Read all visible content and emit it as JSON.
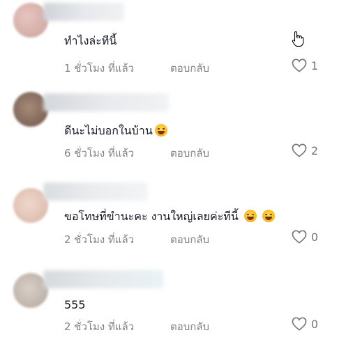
{
  "comments": [
    {
      "text": "ทำไงล่ะทีนี้",
      "time": "1 ชั่วโมง ที่แล้ว",
      "reply": "ตอบกลับ",
      "likes": "1",
      "emojis": 0
    },
    {
      "text": "ดีนะไม่บอกในบ้าน",
      "time": "6 ชั่วโมง ที่แล้ว",
      "reply": "ตอบกลับ",
      "likes": "2",
      "emojis": 1
    },
    {
      "text": "ขอโทษที่ขำนะคะ งานใหญ่เลยค่ะทีนี้",
      "time": "2 ชั่วโมง ที่แล้ว",
      "reply": "ตอบกลับ",
      "likes": "0",
      "emojis": 2
    },
    {
      "text": "555",
      "time": "2 ชั่วโมง ที่แล้ว",
      "reply": "ตอบกลับ",
      "likes": "0",
      "emojis": 0
    }
  ],
  "icons": {
    "like": "heart-icon",
    "cursor": "hand-pointer-icon",
    "emoji": "laughing-emoji-icon"
  }
}
